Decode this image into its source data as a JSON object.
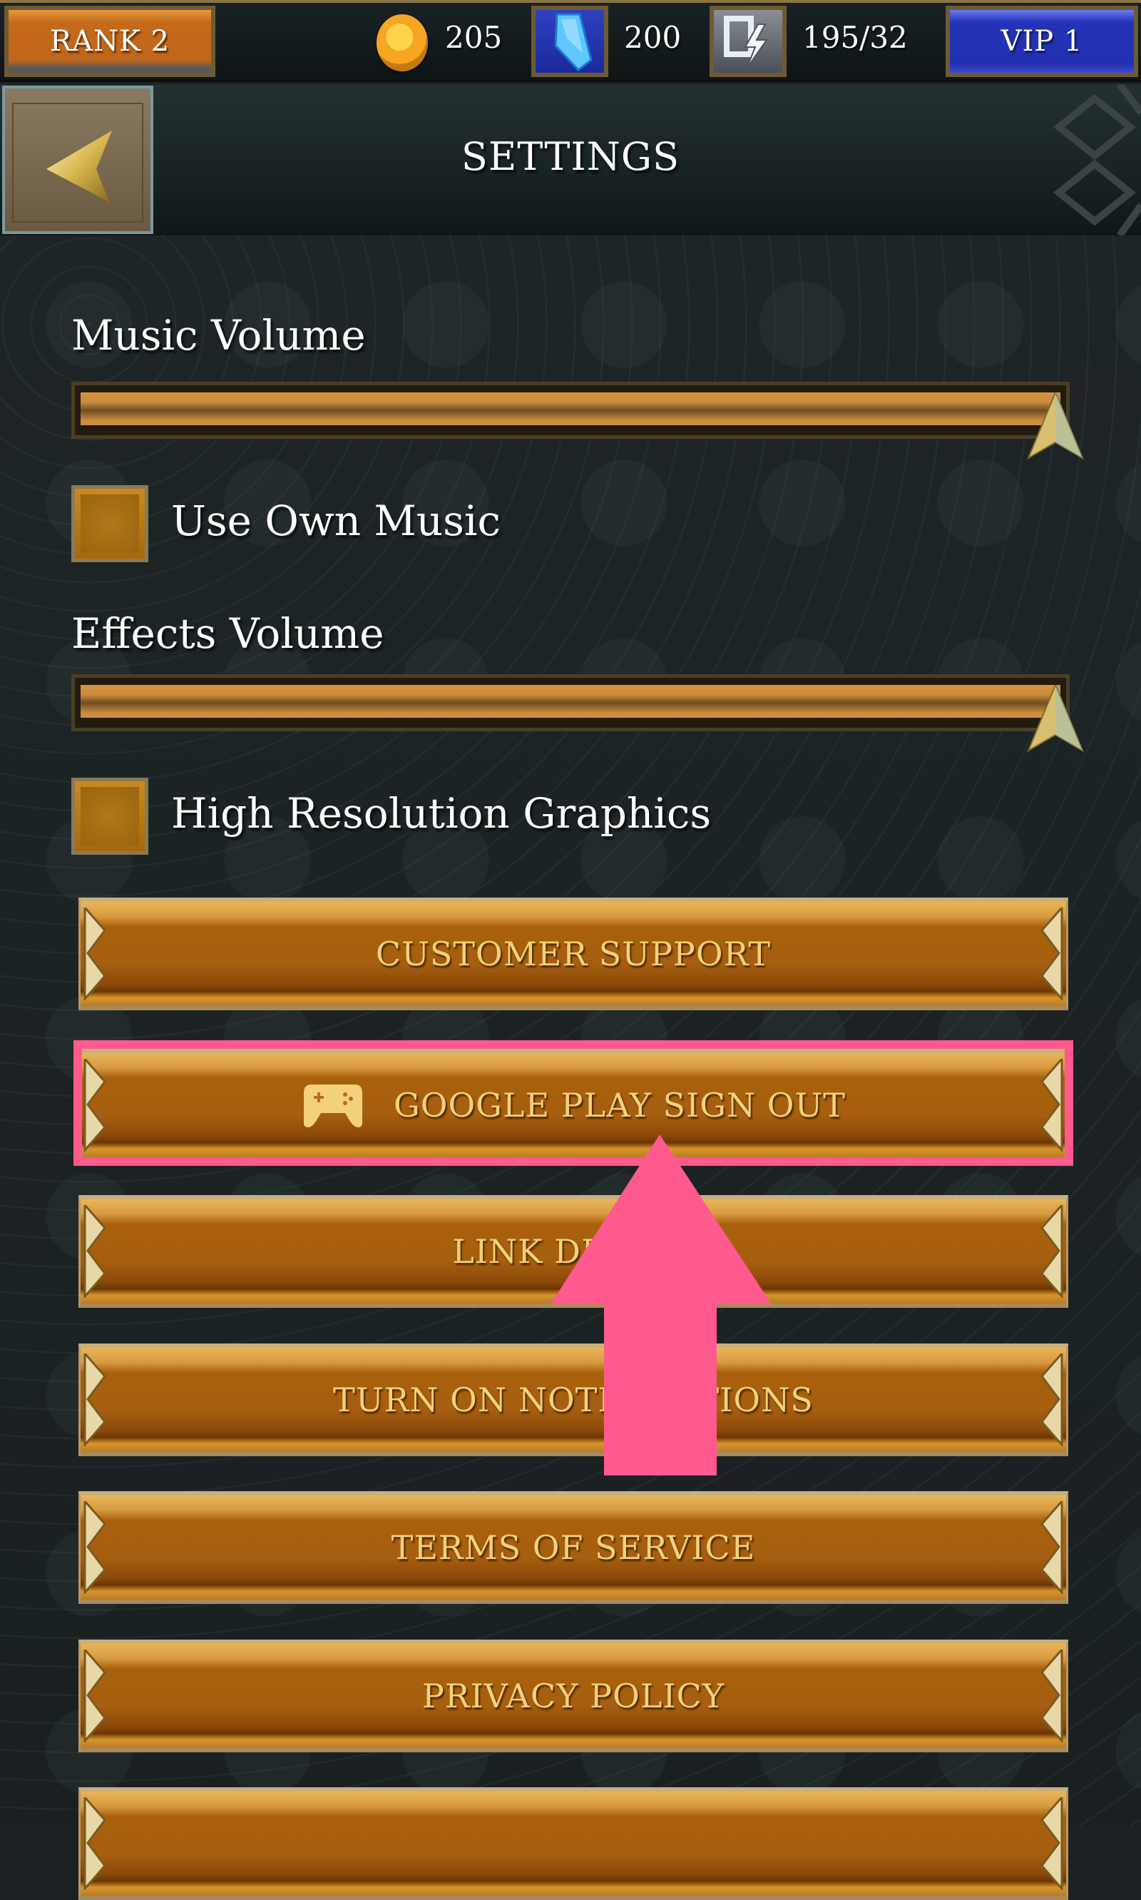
{
  "topbar": {
    "rank_label": "RANK 2",
    "gold": {
      "icon": "coin-icon",
      "value": "205"
    },
    "gems": {
      "icon": "gem-icon",
      "value": "200"
    },
    "energy": {
      "icon": "energy-icon",
      "value": "195/32"
    },
    "vip_label": "VIP 1"
  },
  "header": {
    "back_icon": "back-arrow-icon",
    "title": "SETTINGS"
  },
  "settings": {
    "music_volume": {
      "label": "Music Volume",
      "value_percent": 100
    },
    "use_own_music": {
      "label": "Use Own Music",
      "checked": false
    },
    "effects_volume": {
      "label": "Effects Volume",
      "value_percent": 100
    },
    "high_res_graphics": {
      "label": "High Resolution Graphics",
      "checked": false
    }
  },
  "buttons": [
    {
      "label": "CUSTOMER SUPPORT"
    },
    {
      "label": "GOOGLE PLAY SIGN OUT",
      "icon": "gamepad-icon",
      "highlighted": true
    },
    {
      "label": "LINK DEVICE"
    },
    {
      "label": "TURN ON NOTIFICATIONS"
    },
    {
      "label": "TERMS OF SERVICE"
    },
    {
      "label": "PRIVACY POLICY"
    },
    {
      "label": ""
    }
  ],
  "annotation": {
    "highlight_color": "#ff5a8e",
    "arrow_color": "#ff5a8e",
    "target": "GOOGLE PLAY SIGN OUT"
  }
}
